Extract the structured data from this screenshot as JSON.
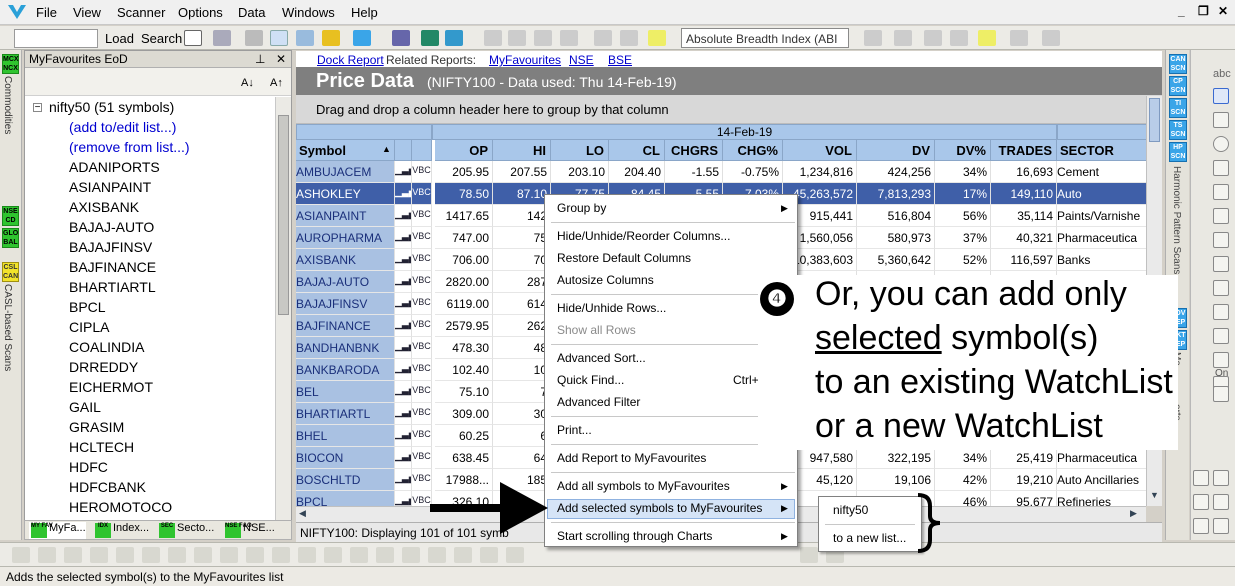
{
  "menu": {
    "items": [
      "File",
      "View",
      "Scanner",
      "Options",
      "Data",
      "Windows",
      "Help"
    ]
  },
  "toolbar": {
    "load_label": "Load",
    "search_label": "Search",
    "breadth_combo": "Absolute Breadth Index (ABI"
  },
  "left_tabs": {
    "mcx_badge": "MCX NCX",
    "commodities": "Commodities",
    "nse_badge": "NSE CD",
    "global_badge": "GLO BAL",
    "casl_badge": "CSL CAN",
    "casl": "CASL-based Scans"
  },
  "fav_panel": {
    "title": "MyFavourites EoD",
    "font_down": "A↓",
    "font_up": "A↑",
    "root": "nifty50 (51 symbols)",
    "add_edit": "(add to/edit list...)",
    "remove": "(remove from list...)",
    "symbols": [
      "ADANIPORTS",
      "ASIANPAINT",
      "AXISBANK",
      "BAJAJ-AUTO",
      "BAJAJFINSV",
      "BAJFINANCE",
      "BHARTIARTL",
      "BPCL",
      "CIPLA",
      "COALINDIA",
      "DRREDDY",
      "EICHERMOT",
      "GAIL",
      "GRASIM",
      "HCLTECH",
      "HDFC",
      "HDFCBANK",
      "HEROMOTOCO"
    ]
  },
  "fav_tabs": [
    {
      "badge": "MY FAV",
      "label": "MyFa..."
    },
    {
      "badge": "IDX",
      "label": "Index..."
    },
    {
      "badge": "SEC",
      "label": "Secto..."
    },
    {
      "badge": "NSE F&O",
      "label": "NSE..."
    }
  ],
  "report": {
    "links": {
      "dock": "Dock Report",
      "related": "Related Reports:",
      "myfav": "MyFavourites",
      "nse": "NSE",
      "bse": "BSE"
    },
    "title": "Price Data",
    "subtitle": "(NIFTY100 - Data used: Thu 14-Feb-19)",
    "group_hint": "Drag and drop a column header here to group by that column",
    "date_header": "14-Feb-19",
    "columns": {
      "symbol": "Symbol",
      "op": "OP",
      "hi": "HI",
      "lo": "LO",
      "cl": "CL",
      "chgrs": "CHGRS",
      "chgp": "CHG%",
      "vol": "VOL",
      "dv": "DV",
      "dvp": "DV%",
      "trades": "TRADES",
      "sector": "SECTOR"
    },
    "icon_label": "VBC",
    "rows": [
      {
        "symbol": "AMBUJACEM",
        "op": "205.95",
        "hi": "207.55",
        "lo": "203.10",
        "cl": "204.40",
        "chgrs": "-1.55",
        "chgp": "-0.75%",
        "vol": "1,234,816",
        "dv": "424,256",
        "dvp": "34%",
        "trades": "16,693",
        "sector": "Cement"
      },
      {
        "symbol": "ASHOKLEY",
        "op": "78.50",
        "hi": "87.10",
        "lo": "77.75",
        "cl": "84.45",
        "chgrs": "5.55",
        "chgp": "7.03%",
        "vol": "45,263,572",
        "dv": "7,813,293",
        "dvp": "17%",
        "trades": "149,110",
        "sector": "Auto"
      },
      {
        "symbol": "ASIANPAINT",
        "op": "1417.65",
        "hi": "142",
        "lo": "",
        "cl": "",
        "chgrs": "",
        "chgp": "",
        "vol": "915,441",
        "dv": "516,804",
        "dvp": "56%",
        "trades": "35,114",
        "sector": "Paints/Varnishe"
      },
      {
        "symbol": "AUROPHARMA",
        "op": "747.00",
        "hi": "75",
        "lo": "",
        "cl": "",
        "chgrs": "",
        "chgp": "",
        "vol": "1,560,056",
        "dv": "580,973",
        "dvp": "37%",
        "trades": "40,321",
        "sector": "Pharmaceutica"
      },
      {
        "symbol": "AXISBANK",
        "op": "706.00",
        "hi": "70",
        "lo": "",
        "cl": "",
        "chgrs": "",
        "chgp": "",
        "vol": "10,383,603",
        "dv": "5,360,642",
        "dvp": "52%",
        "trades": "116,597",
        "sector": "Banks"
      },
      {
        "symbol": "BAJAJ-AUTO",
        "op": "2820.00",
        "hi": "287",
        "lo": "",
        "cl": "",
        "chgrs": "",
        "chgp": "",
        "vol": "",
        "dv": "",
        "dvp": "",
        "trades": "",
        "sector": ""
      },
      {
        "symbol": "BAJAJFINSV",
        "op": "6119.00",
        "hi": "614",
        "lo": "",
        "cl": "",
        "chgrs": "",
        "chgp": "",
        "vol": "",
        "dv": "",
        "dvp": "",
        "trades": "",
        "sector": ""
      },
      {
        "symbol": "BAJFINANCE",
        "op": "2579.95",
        "hi": "262",
        "lo": "",
        "cl": "",
        "chgrs": "",
        "chgp": "",
        "vol": "1,",
        "dv": "",
        "dvp": "",
        "trades": "",
        "sector": ""
      },
      {
        "symbol": "BANDHANBNK",
        "op": "478.30",
        "hi": "48",
        "lo": "",
        "cl": "",
        "chgrs": "",
        "chgp": "",
        "vol": "",
        "dv": "",
        "dvp": "",
        "trades": "",
        "sector": ""
      },
      {
        "symbol": "BANKBARODA",
        "op": "102.40",
        "hi": "10",
        "lo": "",
        "cl": "",
        "chgrs": "",
        "chgp": "",
        "vol": "",
        "dv": "",
        "dvp": "",
        "trades": "",
        "sector": ""
      },
      {
        "symbol": "BEL",
        "op": "75.10",
        "hi": "7",
        "lo": "",
        "cl": "",
        "chgrs": "",
        "chgp": "",
        "vol": "",
        "dv": "",
        "dvp": "",
        "trades": "",
        "sector": ""
      },
      {
        "symbol": "BHARTIARTL",
        "op": "309.00",
        "hi": "30",
        "lo": "",
        "cl": "",
        "chgrs": "",
        "chgp": "",
        "vol": "",
        "dv": "",
        "dvp": "",
        "trades": "",
        "sector": ""
      },
      {
        "symbol": "BHEL",
        "op": "60.25",
        "hi": "6",
        "lo": "",
        "cl": "",
        "chgrs": "",
        "chgp": "",
        "vol": "",
        "dv": "",
        "dvp": "",
        "trades": "",
        "sector": ""
      },
      {
        "symbol": "BIOCON",
        "op": "638.45",
        "hi": "64",
        "lo": "",
        "cl": "",
        "chgrs": "",
        "chgp": "",
        "vol": "947,580",
        "dv": "322,195",
        "dvp": "34%",
        "trades": "25,419",
        "sector": "Pharmaceutica"
      },
      {
        "symbol": "BOSCHLTD",
        "op": "17988...",
        "hi": "185",
        "lo": "",
        "cl": "",
        "chgrs": "",
        "chgp": "",
        "vol": "45,120",
        "dv": "19,106",
        "dvp": "42%",
        "trades": "19,210",
        "sector": "Auto Ancillaries"
      },
      {
        "symbol": "BPCL",
        "op": "326.10",
        "hi": "",
        "lo": "",
        "cl": "",
        "chgrs": "",
        "chgp": "",
        "vol": "",
        "dv": "",
        "dvp": "46%",
        "trades": "95,677",
        "sector": "Refineries"
      }
    ],
    "status": "NIFTY100: Displaying 101 of 101 symb"
  },
  "context_menu": {
    "items": [
      "Group by",
      "Hide/Unhide/Reorder Columns...",
      "Restore Default Columns",
      "Autosize Columns",
      "Hide/Unhide Rows...",
      "Show all Rows",
      "Advanced Sort...",
      "Quick Find...",
      "Advanced Filter",
      "Print...",
      "Add Report to MyFavourites",
      "Add all symbols to MyFavourites",
      "Add selected symbols to MyFavourites",
      "Start scrolling through Charts"
    ],
    "quick_find_shortcut": "Ctrl+F"
  },
  "submenu": {
    "items": [
      "nifty50",
      "to a new list..."
    ]
  },
  "annotation": {
    "number": "❹",
    "line1": "Or, you can add only",
    "line2a": "selected",
    "line2b": " symbol(s)",
    "line3": "to an existing WatchList",
    "line4": "or a new WatchList"
  },
  "right_strip": {
    "badges": [
      "CAN SCN",
      "CP SCN",
      "TI SCN",
      "TS SCN",
      "HP SCN"
    ],
    "harmonic": "Harmonic Pattern Scans",
    "badges2": [
      "ADV REP",
      "MKT REP"
    ],
    "mar": "Ma",
    "orts": "orts"
  },
  "draw_tools": {
    "abc": "abc",
    "on": "On"
  },
  "statusbar": {
    "text": "Adds the selected symbol(s) to the MyFavourites list"
  },
  "colors": {
    "selected_row": "#3f5fa8",
    "symbol_col": "#a9c1e2",
    "header": "#a9c7ea",
    "title_bar": "#7f7f7f",
    "menu_highlight": "#d5e4f7"
  }
}
